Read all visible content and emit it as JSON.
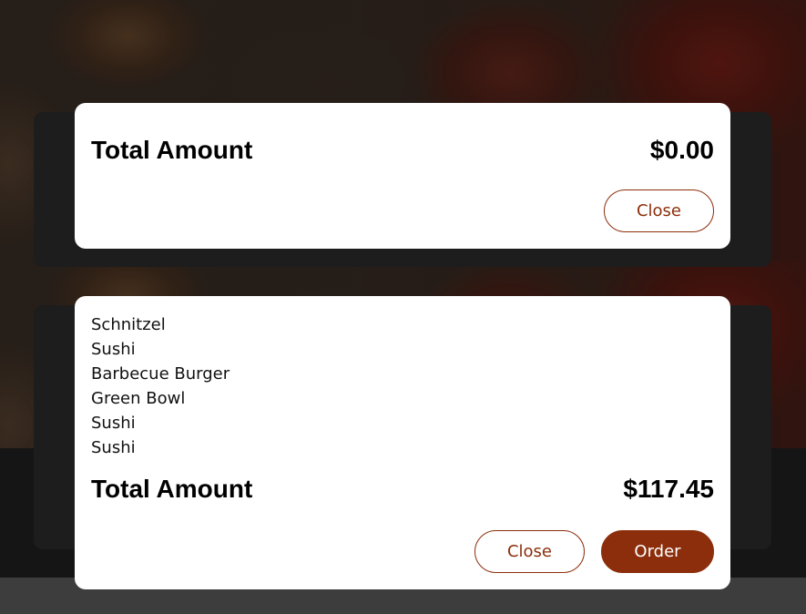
{
  "colors": {
    "accent": "#8c2e0b",
    "modal_bg": "#ffffff",
    "overlay": "#2a2623"
  },
  "cart_modal_empty": {
    "total_label": "Total Amount",
    "total_value": "$0.00",
    "close_label": "Close"
  },
  "cart_modal_filled": {
    "items": [
      "Schnitzel",
      "Sushi",
      "Barbecue Burger",
      "Green Bowl",
      "Sushi",
      "Sushi"
    ],
    "total_label": "Total Amount",
    "total_value": "$117.45",
    "close_label": "Close",
    "order_label": "Order"
  }
}
